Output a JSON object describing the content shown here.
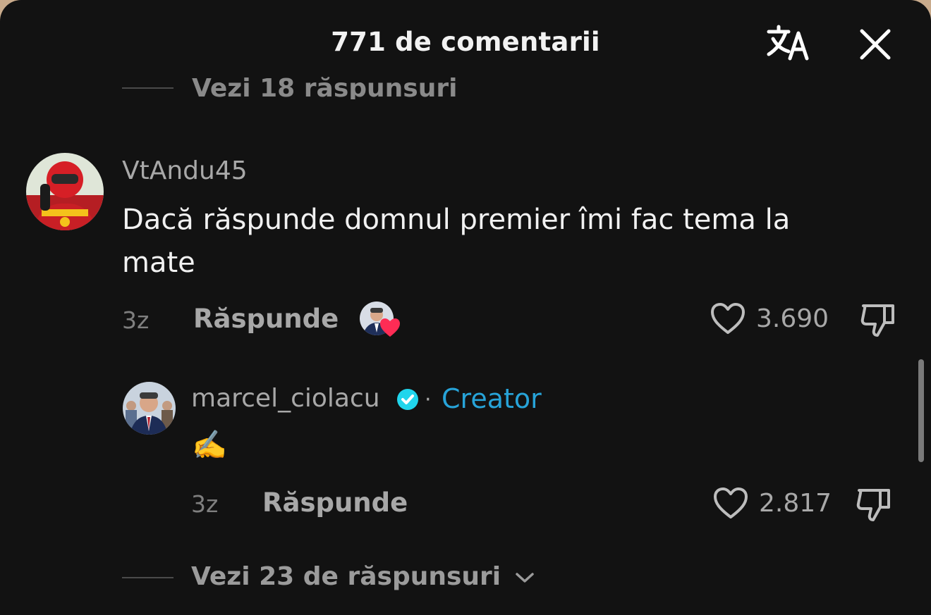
{
  "header": {
    "title": "771 de comentarii"
  },
  "faded_replies_label": "Vezi 18 răspunsuri",
  "comment": {
    "username": "VtAndu45",
    "text": "Dacă răspunde domnul premier îmi fac tema la mate",
    "age": "3z",
    "reply_label": "Răspunde",
    "likes": "3.690"
  },
  "reply": {
    "username": "marcel_ciolacu",
    "separator": "·",
    "badge": "Creator",
    "text": "✍️",
    "age": "3z",
    "reply_label": "Răspunde",
    "likes": "2.817"
  },
  "more_replies_label": "Vezi 23 de răspunsuri",
  "colors": {
    "background": "#121212",
    "creator": "#27a3d8",
    "heart": "#fe2c55",
    "verified": "#20d5ec"
  }
}
